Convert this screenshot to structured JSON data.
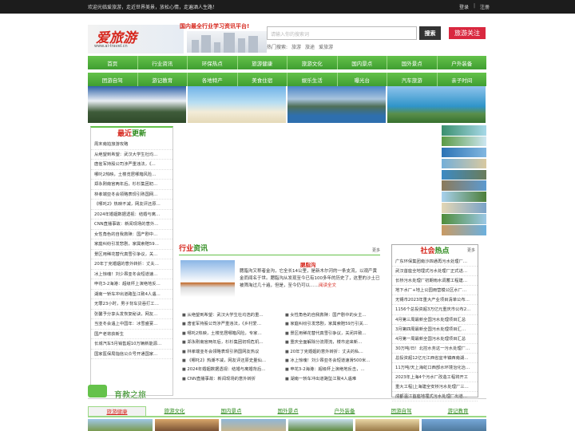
{
  "topbar": {
    "welcome": "欢迎光临爱旅游，走近世界美景，放松心情，走遍酒人生路！",
    "login": "登录",
    "sep": "|",
    "register": "注册"
  },
  "header": {
    "logo_text": "爱旅游",
    "logo_url": "www.ai-travel.cn",
    "slogan": "国内最全行业学习资讯平台!",
    "search_placeholder": "请输入你的搜索词",
    "search_button": "搜索",
    "hot_label": "热门搜索:",
    "hot_terms": [
      "旅游",
      "旅途",
      "爱旅游"
    ],
    "follow": "旅游关注"
  },
  "nav_row1": [
    "首页",
    "行业资讯",
    "环保热点",
    "旅游健康",
    "旅游文化",
    "国内景点",
    "国外景点",
    "户外装备"
  ],
  "nav_row2": [
    "团游自驾",
    "游记教育",
    "各地特产",
    "美食住宿",
    "娱乐生活",
    "曝光台",
    "汽车旅游",
    "亲子时间"
  ],
  "latest": {
    "title_a": "最近",
    "title_b": "更新",
    "items": [
      "周末南拍旅游攻略",
      "从绝望到希望：武汉大学生杜均…",
      "唐雀军持股公司涉严重违法，《…",
      "哪吒2热映，土楼览居哪箱风险…",
      "郑永刚南官两年后，杉杉集团初…",
      "林孝端亚冬会领略表现引熟国网…",
      "《哪吒2》热映不减，网友评还原…",
      "2024年婚姻数据透视：结婚与离…",
      "CNN直播事故：新闻现场的意外…",
      "女性角色的自我救赎：国产剧中…",
      "家庭纠纷引发悲剧，家属索赔59…",
      "景区用稀花替代真雪引争议，关…",
      "20年丁克婚姻的意外转折：丈夫…",
      "冰上惊魂！刘少昂亚冬会短道速…",
      "申花3-2海港：超级杯上演绝地反…",
      "湖南一轿车冲出道路坠江致4人遇…",
      "无罪23小时，男子背车贷吞打工…",
      "张馨予分享头发恢复秘诀，网友…",
      "当亚冬会遇上中国年：冰雪盛宴…",
      "国产老将获新生",
      "长城汽车5月销售超10万辆新能源…",
      "国家医保局指信公众号开通国家…"
    ]
  },
  "industry": {
    "title_a": "行业",
    "title_b": "资讯",
    "more": "更多",
    "feature_title": "腮脂沟",
    "feature_desc": "腮脂沟又称者金沟，它全长14公里，是新木尔河的一条支流，以观产黄金而闻名于世。腮脂沟从发现至今已有100多年的历史了，这里的沙土已被筛淘过几十遍，但是，至今仍可以……",
    "read_all": "阅读全文",
    "list": [
      "从绝望到希望：武汉大学生杜均浩的重…",
      "女性角色的自我救赎：国产剧中的女主…",
      "唐雀军持股公司涉严重违法，《乡村爱…",
      "家庭纠纷引发悲剧，家属索赔59万引关…",
      "哪吒2热映，土楼览居哪箱风险，专家…",
      "景区用稀花替代真雪引争议，关闭并致…",
      "郑永刚南官两年后，杉杉集团初现危机…",
      "重庆全面解除分流限流，楼市迎来新…",
      "林孝端亚冬会领略表现引熟国网友热议",
      "20年丁克婚姻的意外转折：丈夫的私…",
      "《哪吒2》热潮不减，网友评还原史量仙…",
      "冰上惊魂！刘少昂亚冬会短道速滑500米…",
      "2024年婚姻数据透视：结婚与离婚背后…",
      "申花3-2海港：超级杯上演绝地反击，…",
      "CNN直播事故：新闻现场的意外转折",
      "湖南一轿车冲出道路坠江致4人遇难"
    ]
  },
  "social": {
    "title_a": "社会",
    "title_b": "热点",
    "more": "更多",
    "items": [
      "广东环保集团南沙四通再污水处理厂…",
      "武汉首座全地埋式污水处理厂正式进…",
      "长桥污水处理厂初期雨水调蓄工程建…",
      "地下水厂+地上公园雨营模公区水厂…",
      "无锡市2023年重大产业项目清单公布…",
      "1156个总投资超3万亿元重庆市公布2…",
      "4月第三周最新全国污水处理项目汇总",
      "3月第四周最新全国污水处理项目汇…",
      "4月第一周最新全国污水处理项目汇总",
      "30万吨/日！北控水务这一污水处理厂…",
      "总投资超12亿元江西省宜丰镇西南湖…",
      "11万吨/天上海虹口西部水环境治化治…",
      "2023年上海4个污水厂改造工程将开工",
      "重大工程|上海建全安桥污水处理厂三…",
      "成都温江首座地埋式污水处理厂出道…"
    ]
  },
  "tourism": {
    "title": "育教之旅",
    "tabs": [
      "旅游健康",
      "旅游文化",
      "国内景点",
      "国外景点",
      "户外装备",
      "团游自驾",
      "游记教育"
    ]
  }
}
